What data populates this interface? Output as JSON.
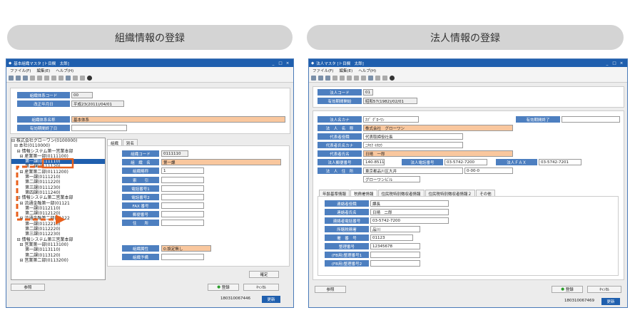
{
  "headers": {
    "left": "組織情報の登録",
    "right": "法人情報の登録"
  },
  "menu": {
    "file": "ファイル(F)",
    "edit": "編集(E)",
    "help": "ヘルプ(H)"
  },
  "left": {
    "title": "基本組織マスタ [ト目欄　太郎]",
    "top_fields": [
      {
        "label": "組織体系コード",
        "value": "00"
      },
      {
        "label": "改正年月日",
        "value": "平成23(2011)/04/01"
      },
      {
        "label": "組織体系名称",
        "value": "基本体系"
      },
      {
        "label": "有効期間終了日",
        "value": ""
      }
    ],
    "tree": [
      "⊟ 株式会社グローワン(0100000)",
      "  ⊟ 本社(0110000)",
      "    ⊟ 情報システム第一営業本部",
      "      ⊟ 産業第一部(0111100)",
      "          第一課(0111110)",
      "          第二課(0111120)",
      "      ⊟ 産業第二部(0111200)",
      "          第一課(0111210)",
      "          第二課(0111220)",
      "          第三課(0111230)",
      "          第四課(0111240)",
      "    ⊟ 情報システム第二営業本部",
      "      ⊟ 流通金融第一部(01121",
      "          第一課(0112110)",
      "          第二課(0112120)",
      "      ⊟ 流通金融第二部(01122",
      "          第一課(0112210)",
      "          第二課(0112220)",
      "          第三課(0112230)",
      "    ⊟ 情報システム第三営業本部",
      "      ⊟ 営業第一部(0113100)",
      "          第一課(0113110)",
      "          第二課(0113120)",
      "      ⊟ 営業第二部(0113200)"
    ],
    "tabs": [
      "組織",
      "別名"
    ],
    "fields": [
      {
        "label": "組織コード",
        "value": "0111110"
      },
      {
        "label": "組　織　名",
        "value": "第一課"
      },
      {
        "label": "組織略称",
        "value": "1"
      },
      {
        "label": "索　　引",
        "value": ""
      },
      {
        "label": "電話番号1",
        "value": ""
      },
      {
        "label": "電話番号2",
        "value": ""
      },
      {
        "label": "FAX 番号",
        "value": ""
      },
      {
        "label": "郵便番号",
        "value": ""
      },
      {
        "label": "住　　所",
        "value": ""
      },
      {
        "label": "組織属性",
        "value": "0:設定無し"
      },
      {
        "label": "組織予備",
        "value": ""
      }
    ],
    "confirm": "確定",
    "ref": "参照",
    "register": "登録",
    "cancel": "ｷｬﾝｾﾙ",
    "code": "180310067446",
    "update": "更新"
  },
  "right": {
    "title": "法人マスタ [ト目欄　太郎]",
    "f1": [
      {
        "label": "法人コード",
        "value": "01"
      },
      {
        "label": "有効期間開始",
        "value": "昭和57(1982)/02/01"
      }
    ],
    "name_kana": {
      "label": "法人名カナ",
      "value": "ｶﾌﾞ ｸﾞﾛｰﾜﾝ"
    },
    "valid_end": {
      "label": "有効期間終了",
      "value": ""
    },
    "name": {
      "label": "法　人　名　称",
      "value": "株式会社　グローワン"
    },
    "rep_title": {
      "label": "代表者役職",
      "value": "代表取締役社長"
    },
    "rep_kana": {
      "label": "代表者氏名カナ",
      "value": "ﾆﾁﾓｸ ｲﾁﾛｳ"
    },
    "rep_name": {
      "label": "代表者氏名",
      "value": "日晴　一郎"
    },
    "zip": {
      "label": "法人郵便番号",
      "value": "140-8511"
    },
    "tel": {
      "label": "法人電話番号",
      "value": "03-5742-7200"
    },
    "fax": {
      "label": "法人ＦＡＸ",
      "value": "03-5742-7201"
    },
    "addr": {
      "label": "法　人　住　所",
      "value": "東京都品川区大井",
      "value2": "0-00-0",
      "value3": "グローワンビル"
    },
    "tabs": [
      "年齢基準情報",
      "税務署情報",
      "住民税特別徴収者情報",
      "住民税特別徴収者情報２",
      "その他"
    ],
    "tax": [
      {
        "label": "連絡者役職",
        "value": "課長"
      },
      {
        "label": "連絡者氏名",
        "value": "日晴　二郎"
      },
      {
        "label": "連絡者電話番号",
        "value": "03-5742-7200"
      },
      {
        "label": "所轄税務署",
        "value": "品川"
      },
      {
        "label": "署　番　号",
        "value": "01123"
      },
      {
        "label": "整理番号",
        "value": "12345678"
      },
      {
        "label": "(FB用)整理番号1",
        "value": ""
      },
      {
        "label": "(FB用)整理番号2",
        "value": ""
      }
    ],
    "ref": "参照",
    "register": "登録",
    "cancel": "ｷｬﾝｾﾙ",
    "code": "180310067469",
    "update": "更新"
  },
  "colors": {
    "accent": "#1f5fae",
    "label": "#4d7fc0",
    "highlight": "#f9c79e",
    "arrow": "#e8601c"
  }
}
